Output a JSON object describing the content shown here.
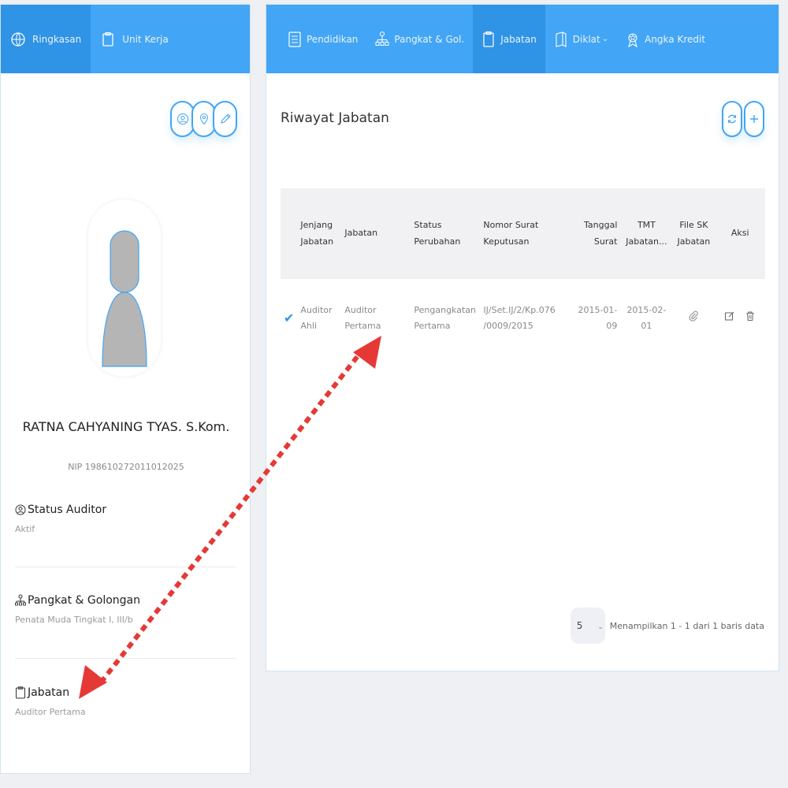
{
  "left": {
    "tabs": [
      {
        "label": "Ringkasan",
        "icon": "globe-icon",
        "active": true
      },
      {
        "label": "Unit Kerja",
        "icon": "clipboard-icon",
        "active": false
      }
    ],
    "actions": [
      "user-circle-icon",
      "location-pin-icon",
      "pencil-icon"
    ],
    "profile": {
      "name": "RATNA CAHYANING TYAS. S.Kom.",
      "nip": "NIP 198610272011012025"
    },
    "info": [
      {
        "title": "Status Auditor",
        "value": "Aktif",
        "icon": "user-circle-icon"
      },
      {
        "title": "Pangkat & Golongan",
        "value": "Penata Muda Tingkat I, III/b",
        "icon": "hierarchy-icon"
      },
      {
        "title": "Jabatan",
        "value": "Auditor Pertama",
        "icon": "clipboard-icon"
      }
    ]
  },
  "right": {
    "tabs": [
      {
        "label": "Pendidikan",
        "icon": "list-icon",
        "active": false
      },
      {
        "label": "Pangkat & Gol.",
        "icon": "hierarchy-icon",
        "active": false
      },
      {
        "label": "Jabatan",
        "icon": "clipboard-icon",
        "active": true
      },
      {
        "label": "Diklat",
        "icon": "book-icon",
        "active": false
      },
      {
        "label": "Angka Kredit",
        "icon": "badge-icon",
        "active": false
      }
    ],
    "diklat_chevron": "⌄",
    "title": "Riwayat Jabatan",
    "table": {
      "headers": [
        [
          "Jenjang",
          "Jabatan"
        ],
        [
          "Jabatan"
        ],
        [
          "Status",
          "Perubahan"
        ],
        [
          "Nomor Surat",
          "Keputusan"
        ],
        [
          "Tanggal",
          "Surat"
        ],
        [
          "TMT",
          "Jabatan..."
        ],
        [
          "File SK",
          "Jabatan"
        ],
        [
          "Aksi"
        ]
      ],
      "row": {
        "jenjang": "Auditor Ahli",
        "jabatan": "Auditor Pertama",
        "status_1": "Pengangkatan",
        "status_2": "Pertama",
        "nomor_1": "IJ/Set.IJ/2/Kp.076",
        "nomor_2": "/0009/2015",
        "tanggal": "2015-01-09",
        "tmt": "2015-02-01"
      }
    },
    "footer": {
      "page_size": "5",
      "summary": "Menampilkan 1 - 1 dari 1 baris data"
    }
  },
  "colors": {
    "primary": "#42a5f5",
    "primary_dark": "#2f93e6",
    "annotation": "#e53935"
  }
}
